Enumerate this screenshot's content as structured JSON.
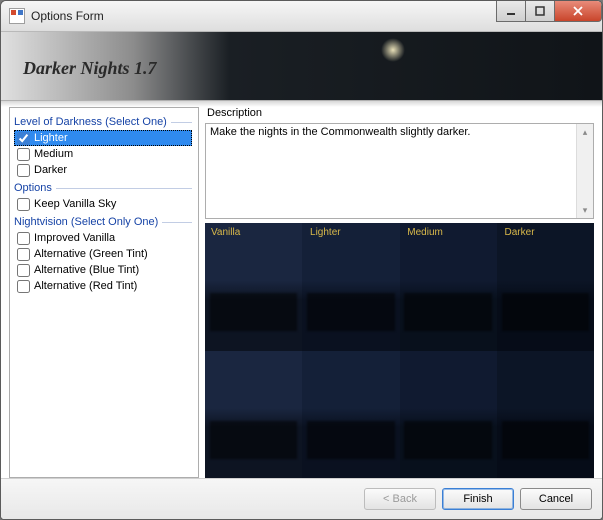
{
  "window": {
    "title": "Options Form"
  },
  "banner": {
    "title": "Darker Nights 1.7"
  },
  "left": {
    "darkness_header": "Level of Darkness (Select One)",
    "darkness_items": [
      "Lighter",
      "Medium",
      "Darker"
    ],
    "darkness_selected_index": 0,
    "options_header": "Options",
    "options_items": [
      "Keep Vanilla Sky"
    ],
    "night_header": "Nightvision (Select Only One)",
    "night_items": [
      "Improved Vanilla",
      "Alternative (Green Tint)",
      "Alternative (Blue Tint)",
      "Alternative (Red Tint)"
    ]
  },
  "description": {
    "label": "Description",
    "text": "Make the nights in the Commonwealth slightly darker."
  },
  "preview": {
    "labels": [
      "Vanilla",
      "Lighter",
      "Medium",
      "Darker"
    ]
  },
  "footer": {
    "back": "< Back",
    "finish": "Finish",
    "cancel": "Cancel"
  }
}
